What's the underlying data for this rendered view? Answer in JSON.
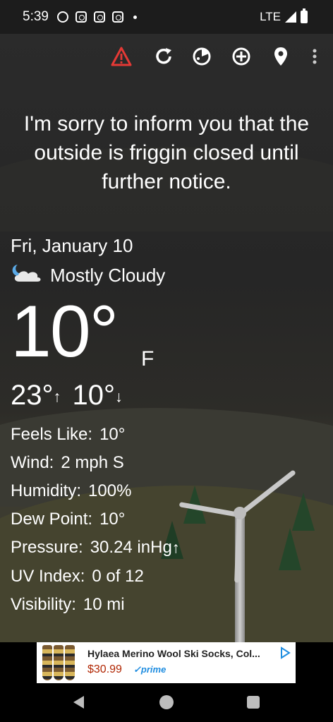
{
  "status_bar": {
    "time": "5:39",
    "network": "LTE",
    "notification_icons": [
      "alarm-icon",
      "instagram-icon",
      "instagram-icon",
      "instagram-icon"
    ]
  },
  "toolbar": {
    "icons": [
      "warning-icon",
      "refresh-icon",
      "radar-icon",
      "add-location-icon",
      "location-pin-icon",
      "more-options-icon"
    ],
    "warning_color": "#e53935"
  },
  "message": "I'm sorry to inform you that the outside is friggin closed until further notice.",
  "weather": {
    "date": "Fri, January 10",
    "condition": "Mostly Cloudy",
    "condition_icon": "mostly-cloudy-night-icon",
    "temperature": "10°",
    "unit": "F",
    "high": "23°",
    "high_arrow": "↑",
    "low": "10°",
    "low_arrow": "↓"
  },
  "details": {
    "feels_like": {
      "label": "Feels Like:",
      "value": "10°"
    },
    "wind": {
      "label": "Wind:",
      "value": "2 mph S"
    },
    "humidity": {
      "label": "Humidity:",
      "value": "100%"
    },
    "dew_point": {
      "label": "Dew Point:",
      "value": "10°"
    },
    "pressure": {
      "label": "Pressure:",
      "value": "30.24 inHg",
      "trend": "↑"
    },
    "uv_index": {
      "label": "UV Index:",
      "value": "0 of 12"
    },
    "visibility": {
      "label": "Visibility:",
      "value": "10 mi"
    }
  },
  "ad": {
    "title": "Hylaea Merino Wool Ski Socks, Col...",
    "price": "$30.99",
    "prime": "✓prime"
  }
}
